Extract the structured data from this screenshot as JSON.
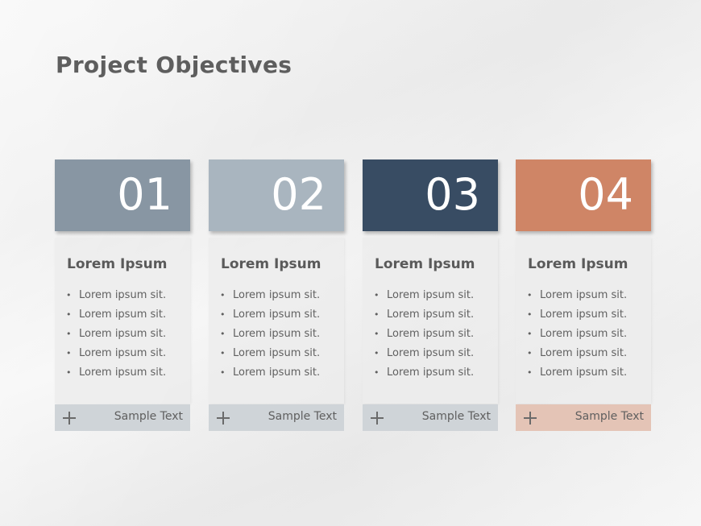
{
  "title": "Project Objectives",
  "colors": {
    "card1": "#8896a3",
    "card2": "#a9b5bf",
    "card3": "#384c63",
    "card4": "#cf8566",
    "footer_gray": "#cfd4d8",
    "footer_accent": "#e4c4b6"
  },
  "cards": [
    {
      "number": "01",
      "heading": "Lorem Ipsum",
      "bullets": [
        "Lorem ipsum  sit.",
        "Lorem ipsum  sit.",
        "Lorem ipsum  sit.",
        "Lorem ipsum  sit.",
        "Lorem ipsum  sit."
      ],
      "footer_icon": "plus-icon",
      "footer_text": "Sample Text"
    },
    {
      "number": "02",
      "heading": "Lorem Ipsum",
      "bullets": [
        "Lorem ipsum  sit.",
        "Lorem ipsum  sit.",
        "Lorem ipsum  sit.",
        "Lorem ipsum  sit.",
        "Lorem ipsum  sit."
      ],
      "footer_icon": "plus-icon",
      "footer_text": "Sample Text"
    },
    {
      "number": "03",
      "heading": "Lorem Ipsum",
      "bullets": [
        "Lorem ipsum  sit.",
        "Lorem ipsum  sit.",
        "Lorem ipsum  sit.",
        "Lorem ipsum  sit.",
        "Lorem ipsum  sit."
      ],
      "footer_icon": "plus-icon",
      "footer_text": "Sample Text"
    },
    {
      "number": "04",
      "heading": "Lorem Ipsum",
      "bullets": [
        "Lorem ipsum  sit.",
        "Lorem ipsum  sit.",
        "Lorem ipsum  sit.",
        "Lorem ipsum  sit.",
        "Lorem ipsum  sit."
      ],
      "footer_icon": "plus-icon",
      "footer_text": "Sample Text"
    }
  ]
}
